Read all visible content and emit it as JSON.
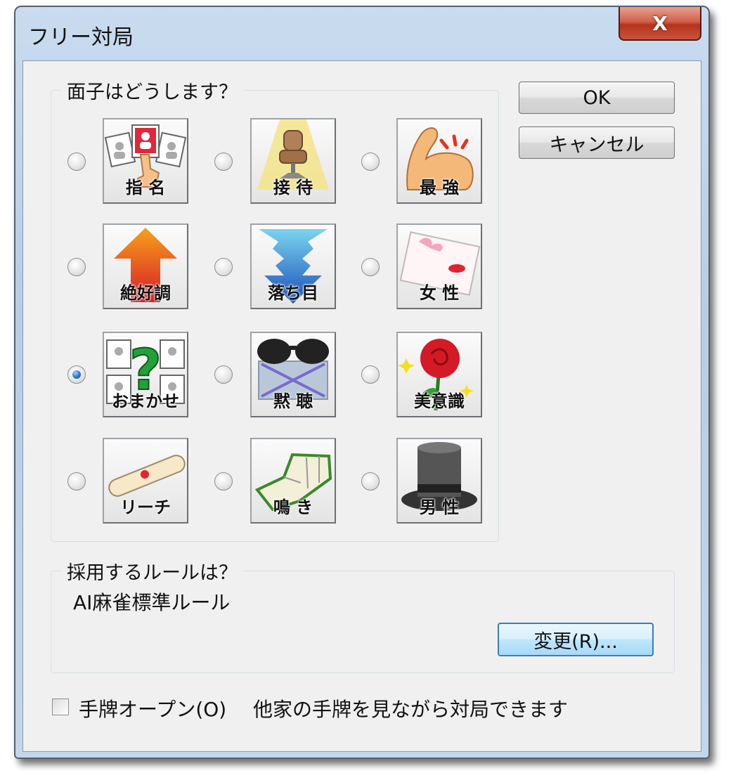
{
  "window": {
    "title": "フリー対局",
    "close_label": "X"
  },
  "opponent_group": {
    "legend": "面子はどうします？",
    "options": [
      {
        "label": "指 名",
        "icon": "photo-cards-pointing-icon",
        "selected": false
      },
      {
        "label": "接 待",
        "icon": "spotlight-chair-icon",
        "selected": false
      },
      {
        "label": "最 強",
        "icon": "flexed-arm-icon",
        "selected": false
      },
      {
        "label": "絶好調",
        "icon": "up-arrow-icon",
        "selected": false
      },
      {
        "label": "落ち目",
        "icon": "down-arrow-icon",
        "selected": false
      },
      {
        "label": "女 性",
        "icon": "letter-lipstick-icon",
        "selected": false
      },
      {
        "label": "おまかせ",
        "icon": "question-mark-cards-icon",
        "selected": true
      },
      {
        "label": "黙 聴",
        "icon": "sunglasses-icon",
        "selected": false
      },
      {
        "label": "美意識",
        "icon": "rose-icon",
        "selected": false
      },
      {
        "label": "リーチ",
        "icon": "riichi-stick-icon",
        "selected": false
      },
      {
        "label": "鳴 き",
        "icon": "mahjong-tiles-icon",
        "selected": false
      },
      {
        "label": "男 性",
        "icon": "top-hat-icon",
        "selected": false
      }
    ]
  },
  "buttons": {
    "ok": "OK",
    "cancel": "キャンセル"
  },
  "rule_group": {
    "legend": "採用するルールは？",
    "value": "AI麻雀標準ルール",
    "change_button": "変更(R)..."
  },
  "open_hand": {
    "label": "手牌オープン(O)",
    "checked": false,
    "description": "他家の手牌を見ながら対局できます"
  }
}
